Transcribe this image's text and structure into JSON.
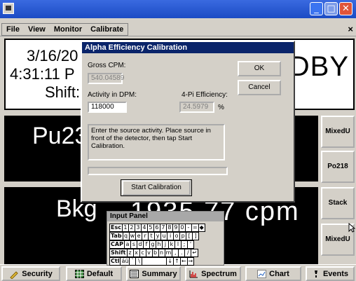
{
  "window": {
    "buttons": {
      "min": "_",
      "max": "□",
      "close": "✕"
    }
  },
  "menubar": {
    "items": [
      "File",
      "View",
      "Monitor",
      "Calibrate"
    ],
    "close": "×"
  },
  "status": {
    "date": "3/16/20",
    "time": "4:31:11 P",
    "shift": "Shift:",
    "mode": "NDBY"
  },
  "readout": {
    "isotope": "Pu239",
    "bkg_label": "Bkg",
    "bkg_value": "1935.77 cpm"
  },
  "side_buttons": [
    "MixedU",
    "Po218",
    "Stack",
    "MixedU"
  ],
  "tabs": [
    "Security",
    "Default",
    "Summary",
    "Spectrum",
    "Chart",
    "Events"
  ],
  "dialog": {
    "title": "Alpha Efficiency Calibration",
    "gross_cpm_label": "Gross CPM:",
    "gross_cpm_value": "540.04589",
    "activity_label": "Activity in DPM:",
    "activity_value": "118000",
    "efficiency_label": "4-Pi Efficiency:",
    "efficiency_value": "24.5979",
    "efficiency_unit": "%",
    "ok": "OK",
    "cancel": "Cancel",
    "message": "Enter the source activity. Place source in front of the detector, then tap Start Calibration.",
    "start": "Start Calibration"
  },
  "input_panel": {
    "title": "Input Panel",
    "rows": [
      [
        "Esc",
        "1",
        "2",
        "3",
        "4",
        "5",
        "6",
        "7",
        "8",
        "9",
        "0",
        "-",
        "=",
        "◆"
      ],
      [
        "Tab",
        "q",
        "w",
        "e",
        "r",
        "t",
        "y",
        "u",
        "i",
        "o",
        "p",
        "[",
        "]"
      ],
      [
        "CAP",
        "a",
        "s",
        "d",
        "f",
        "g",
        "h",
        "j",
        "k",
        "l",
        ";",
        "'"
      ],
      [
        "Shift",
        "z",
        "x",
        "c",
        "v",
        "b",
        "n",
        "m",
        ",",
        ".",
        "/",
        "↵"
      ],
      [
        "Ctl",
        "áü",
        "`",
        "\\",
        " ",
        "↓",
        "↑",
        "←",
        "→"
      ]
    ]
  },
  "colors": {
    "titlebar": "#1b4bc4",
    "dialog_title": "#0a246a",
    "panel": "#d4d0c8"
  }
}
